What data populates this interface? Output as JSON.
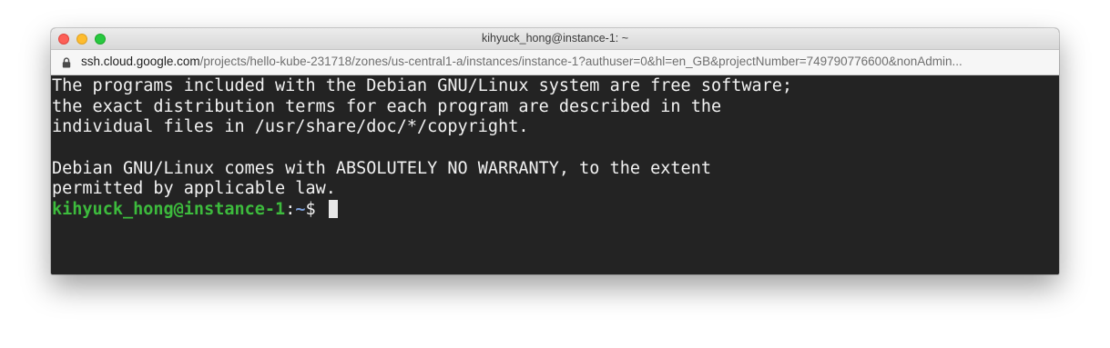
{
  "window": {
    "title": "kihyuck_hong@instance-1: ~"
  },
  "address_bar": {
    "host": "ssh.cloud.google.com",
    "path": "/projects/hello-kube-231718/zones/us-central1-a/instances/instance-1?authuser=0&hl=en_GB&projectNumber=749790776600&nonAdmin..."
  },
  "terminal": {
    "lines": [
      "The programs included with the Debian GNU/Linux system are free software;",
      "the exact distribution terms for each program are described in the",
      "individual files in /usr/share/doc/*/copyright.",
      "",
      "Debian GNU/Linux comes with ABSOLUTELY NO WARRANTY, to the extent",
      "permitted by applicable law."
    ],
    "prompt": {
      "user_host": "kihyuck_hong@instance-1",
      "colon": ":",
      "path": "~",
      "symbol": "$ "
    }
  },
  "colors": {
    "terminal_bg": "#232323",
    "terminal_fg": "#f2f2f2",
    "prompt_user": "#3dbb3d",
    "prompt_path": "#7c9fd9"
  }
}
